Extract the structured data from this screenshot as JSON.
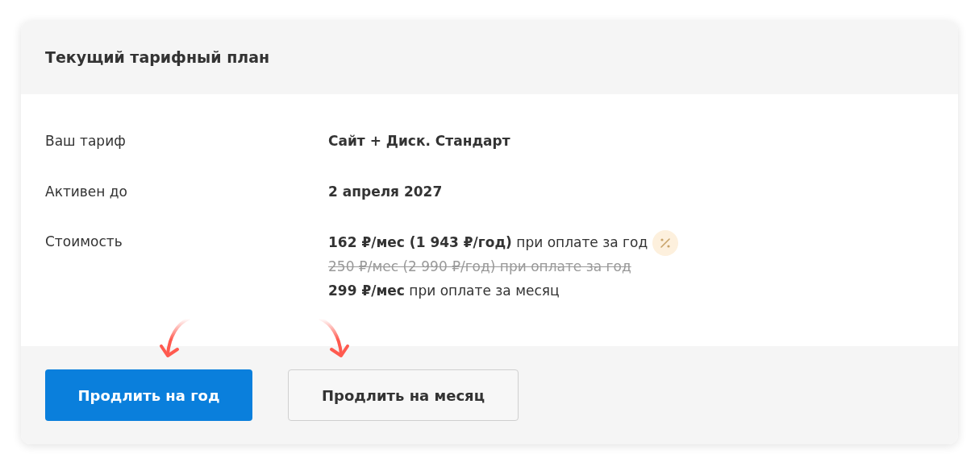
{
  "card": {
    "title": "Текущий тарифный план"
  },
  "details": [
    {
      "label": "Ваш тариф",
      "value": "Сайт + Диск. Стандарт"
    },
    {
      "label": "Активен до",
      "value": "2 апреля 2027"
    }
  ],
  "cost": {
    "label": "Стоимость",
    "prices": [
      {
        "text": "**162 ₽/мес (1 943 ₽/год)** при оплате за год",
        "struck": false,
        "discount_badge": true
      },
      {
        "text": "250 ₽/мес (2 990 ₽/год) при оплате за год",
        "struck": true,
        "discount_badge": false
      },
      {
        "text": "**299 ₽/мес** при оплате за месяц",
        "struck": false,
        "discount_badge": false
      }
    ]
  },
  "buttons": [
    {
      "label": "Продлить на год",
      "kind": "primary"
    },
    {
      "label": "Продлить на месяц",
      "kind": "secondary"
    }
  ]
}
